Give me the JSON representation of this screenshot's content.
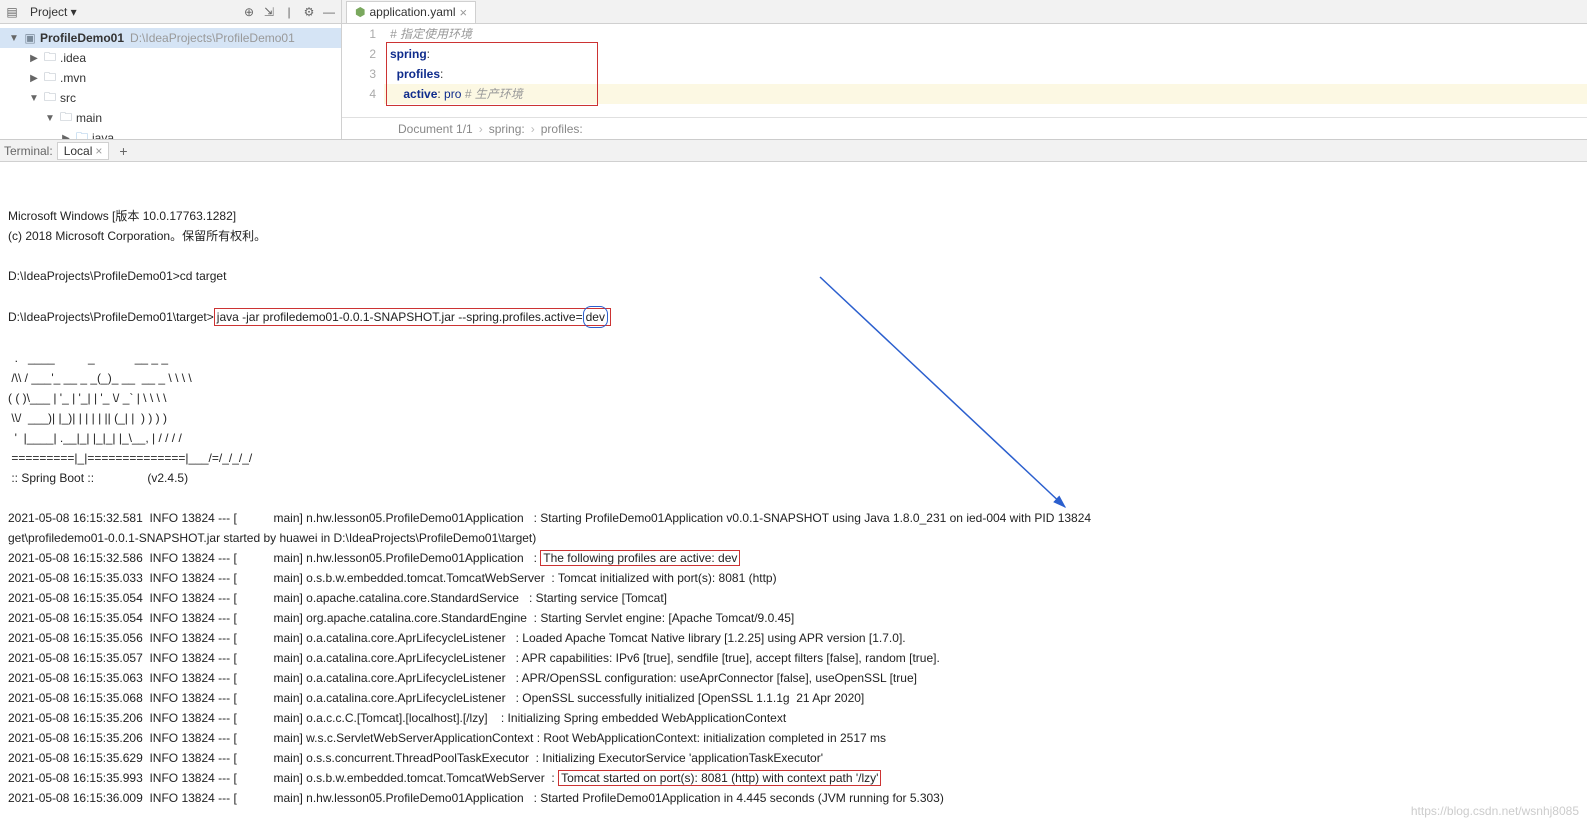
{
  "sidebar": {
    "title": "Project ▾",
    "project": {
      "name": "ProfileDemo01",
      "path": "D:\\IdeaProjects\\ProfileDemo01"
    },
    "nodes": [
      {
        "indent": 28,
        "arrow": "▶",
        "label": ".idea"
      },
      {
        "indent": 28,
        "arrow": "▶",
        "label": ".mvn"
      },
      {
        "indent": 28,
        "arrow": "▼",
        "label": "src"
      },
      {
        "indent": 44,
        "arrow": "▼",
        "label": "main"
      },
      {
        "indent": 60,
        "arrow": "▶",
        "label": "java",
        "blue": true
      }
    ]
  },
  "tab": {
    "name": "application.yaml"
  },
  "code": {
    "lines": [
      {
        "n": "1",
        "html": "<span class='c-comment'># 指定使用环境</span>"
      },
      {
        "n": "2",
        "html": "<span class='c-key'>spring</span>:"
      },
      {
        "n": "3",
        "html": "  <span class='c-key'>profiles</span>:"
      },
      {
        "n": "4",
        "html": "    <span class='c-key'>active</span>: <span class='c-val'>pro</span> <span class='c-comment'># 生产环境</span>",
        "hl": true
      }
    ]
  },
  "crumbs": [
    "Document 1/1",
    "spring:",
    "profiles:"
  ],
  "term_tabs": {
    "label": "Terminal:",
    "tab": "Local"
  },
  "terminal": [
    "Microsoft Windows [版本 10.0.17763.1282]",
    "(c) 2018 Microsoft Corporation。保留所有权利。",
    "",
    "D:\\IdeaProjects\\ProfileDemo01>cd target",
    "",
    {
      "prefix": "D:\\IdeaProjects\\ProfileDemo01\\target>",
      "boxed": "java -jar profiledemo01-0.0.1-SNAPSHOT.jar --spring.profiles.active=",
      "oval": "dev"
    },
    "",
    "  .   ____          _            __ _ _",
    " /\\\\ / ___'_ __ _ _(_)_ __  __ _ \\ \\ \\ \\",
    "( ( )\\___ | '_ | '_| | '_ \\/ _` | \\ \\ \\ \\",
    " \\\\/  ___)| |_)| | | | | || (_| |  ) ) ) )",
    "  '  |____| .__|_| |_|_| |_\\__, | / / / /",
    " =========|_|==============|___/=/_/_/_/",
    " :: Spring Boot ::                (v2.4.5)",
    "",
    "2021-05-08 16:15:32.581  INFO 13824 --- [           main] n.hw.lesson05.ProfileDemo01Application   : Starting ProfileDemo01Application v0.0.1-SNAPSHOT using Java 1.8.0_231 on ied-004 with PID 13824",
    "get\\profiledemo01-0.0.1-SNAPSHOT.jar started by huawei in D:\\IdeaProjects\\ProfileDemo01\\target)",
    {
      "plain_prefix": "2021-05-08 16:15:32.586  INFO 13824 --- [           main] n.hw.lesson05.ProfileDemo01Application   : ",
      "boxed_plain": "The following profiles are active: dev"
    },
    "2021-05-08 16:15:35.033  INFO 13824 --- [           main] o.s.b.w.embedded.tomcat.TomcatWebServer  : Tomcat initialized with port(s): 8081 (http)",
    "2021-05-08 16:15:35.054  INFO 13824 --- [           main] o.apache.catalina.core.StandardService   : Starting service [Tomcat]",
    "2021-05-08 16:15:35.054  INFO 13824 --- [           main] org.apache.catalina.core.StandardEngine  : Starting Servlet engine: [Apache Tomcat/9.0.45]",
    "2021-05-08 16:15:35.056  INFO 13824 --- [           main] o.a.catalina.core.AprLifecycleListener   : Loaded Apache Tomcat Native library [1.2.25] using APR version [1.7.0].",
    "2021-05-08 16:15:35.057  INFO 13824 --- [           main] o.a.catalina.core.AprLifecycleListener   : APR capabilities: IPv6 [true], sendfile [true], accept filters [false], random [true].",
    "2021-05-08 16:15:35.063  INFO 13824 --- [           main] o.a.catalina.core.AprLifecycleListener   : APR/OpenSSL configuration: useAprConnector [false], useOpenSSL [true]",
    "2021-05-08 16:15:35.068  INFO 13824 --- [           main] o.a.catalina.core.AprLifecycleListener   : OpenSSL successfully initialized [OpenSSL 1.1.1g  21 Apr 2020]",
    "2021-05-08 16:15:35.206  INFO 13824 --- [           main] o.a.c.c.C.[Tomcat].[localhost].[/lzy]    : Initializing Spring embedded WebApplicationContext",
    "2021-05-08 16:15:35.206  INFO 13824 --- [           main] w.s.c.ServletWebServerApplicationContext : Root WebApplicationContext: initialization completed in 2517 ms",
    "2021-05-08 16:15:35.629  INFO 13824 --- [           main] o.s.s.concurrent.ThreadPoolTaskExecutor  : Initializing ExecutorService 'applicationTaskExecutor'",
    {
      "plain_prefix": "2021-05-08 16:15:35.993  INFO 13824 --- [           main] o.s.b.w.embedded.tomcat.TomcatWebServer  : ",
      "boxed_plain": "Tomcat started on port(s): 8081 (http) with context path '/lzy'"
    },
    "2021-05-08 16:15:36.009  INFO 13824 --- [           main] n.hw.lesson05.ProfileDemo01Application   : Started ProfileDemo01Application in 4.445 seconds (JVM running for 5.303)"
  ],
  "watermark": "https://blog.csdn.net/wsnhj8085"
}
